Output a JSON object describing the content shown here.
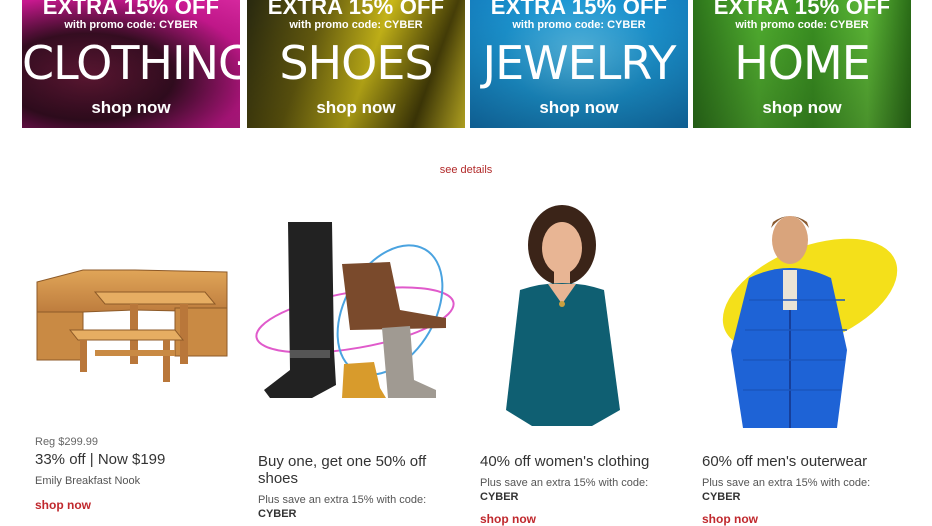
{
  "colors": {
    "accent": "#c0282d",
    "banner_clothing": "#c4148c",
    "banner_shoes": "#c9b81a",
    "banner_jewelry": "#1ea2e0",
    "banner_home": "#3fa02a"
  },
  "banners": [
    {
      "extra": "EXTRA 15% OFF",
      "promo": "with promo code: CYBER",
      "category": "CLOTHING",
      "shop": "shop now"
    },
    {
      "extra": "EXTRA 15% OFF",
      "promo": "with promo code: CYBER",
      "category": "SHOES",
      "shop": "shop now"
    },
    {
      "extra": "EXTRA 15% OFF",
      "promo": "with promo code: CYBER",
      "category": "JEWELRY",
      "shop": "shop now"
    },
    {
      "extra": "EXTRA 15% OFF",
      "promo": "with promo code: CYBER",
      "category": "HOME",
      "shop": "shop now"
    }
  ],
  "see_details": "see details",
  "products": [
    {
      "reg": "Reg $299.99",
      "offer": "33% off | Now $199",
      "desc": "Emily Breakfast Nook",
      "shop": "shop now"
    },
    {
      "offer": "Buy one, get one 50% off shoes",
      "desc": "Plus save an extra 15% with code:",
      "code": "CYBER"
    },
    {
      "offer": "40% off women's clothing",
      "desc": "Plus save an extra 15% with code:",
      "code": "CYBER",
      "shop": "shop now"
    },
    {
      "offer": "60% off men's outerwear",
      "desc": "Plus save an extra 15% with code:",
      "code": "CYBER",
      "shop": "shop now"
    }
  ]
}
